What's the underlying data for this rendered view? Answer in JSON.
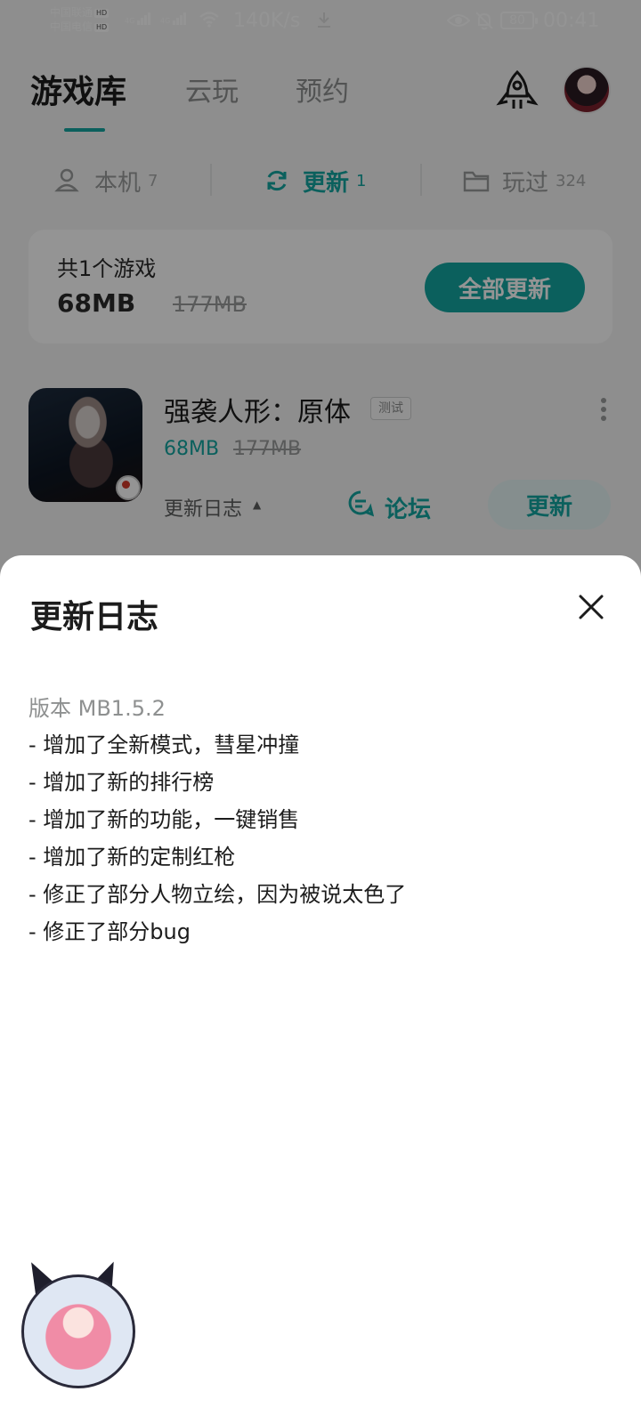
{
  "status_bar": {
    "carrier_1": "中国联通",
    "carrier_2": "中国电信",
    "hd_badge": "HD",
    "network_type_1": "4G",
    "network_type_2": "4G",
    "net_speed": "140K/s",
    "battery": "80",
    "time": "00:41",
    "icons": [
      "wifi-icon",
      "download-icon",
      "eye-icon",
      "bell-off-icon"
    ]
  },
  "header": {
    "tabs": [
      {
        "label": "游戏库",
        "active": true
      },
      {
        "label": "云玩",
        "active": false
      },
      {
        "label": "预约",
        "active": false
      }
    ],
    "icons": [
      "rocket-icon",
      "avatar"
    ]
  },
  "segments": [
    {
      "label": "本机",
      "count": "7",
      "icon": "phone-user-icon"
    },
    {
      "label": "更新",
      "count": "1",
      "icon": "refresh-icon",
      "active": true
    },
    {
      "label": "玩过",
      "count": "324",
      "icon": "folder-icon"
    }
  ],
  "summary": {
    "title": "共1个游戏",
    "size": "68MB",
    "original_size": "177MB",
    "update_all_label": "全部更新"
  },
  "game": {
    "title": "强袭人形：原体",
    "tag": "测试",
    "size": "68MB",
    "original_size": "177MB",
    "changelog_label": "更新日志",
    "forum_label": "论坛",
    "update_label": "更新"
  },
  "sheet": {
    "title": "更新日志",
    "version": "版本 MB1.5.2",
    "notes": [
      "- 增加了全新模式，彗星冲撞",
      "- 增加了新的排行榜",
      "- 增加了新的功能，一键销售",
      "- 增加了新的定制红枪",
      "- 修正了部分人物立绘，因为被说太色了",
      "- 修正了部分bug"
    ]
  },
  "colors": {
    "accent": "#14a6a0",
    "scrim": "rgba(0,0,0,0.42)",
    "text": "#1c1c1c",
    "muted": "#8e9090"
  }
}
